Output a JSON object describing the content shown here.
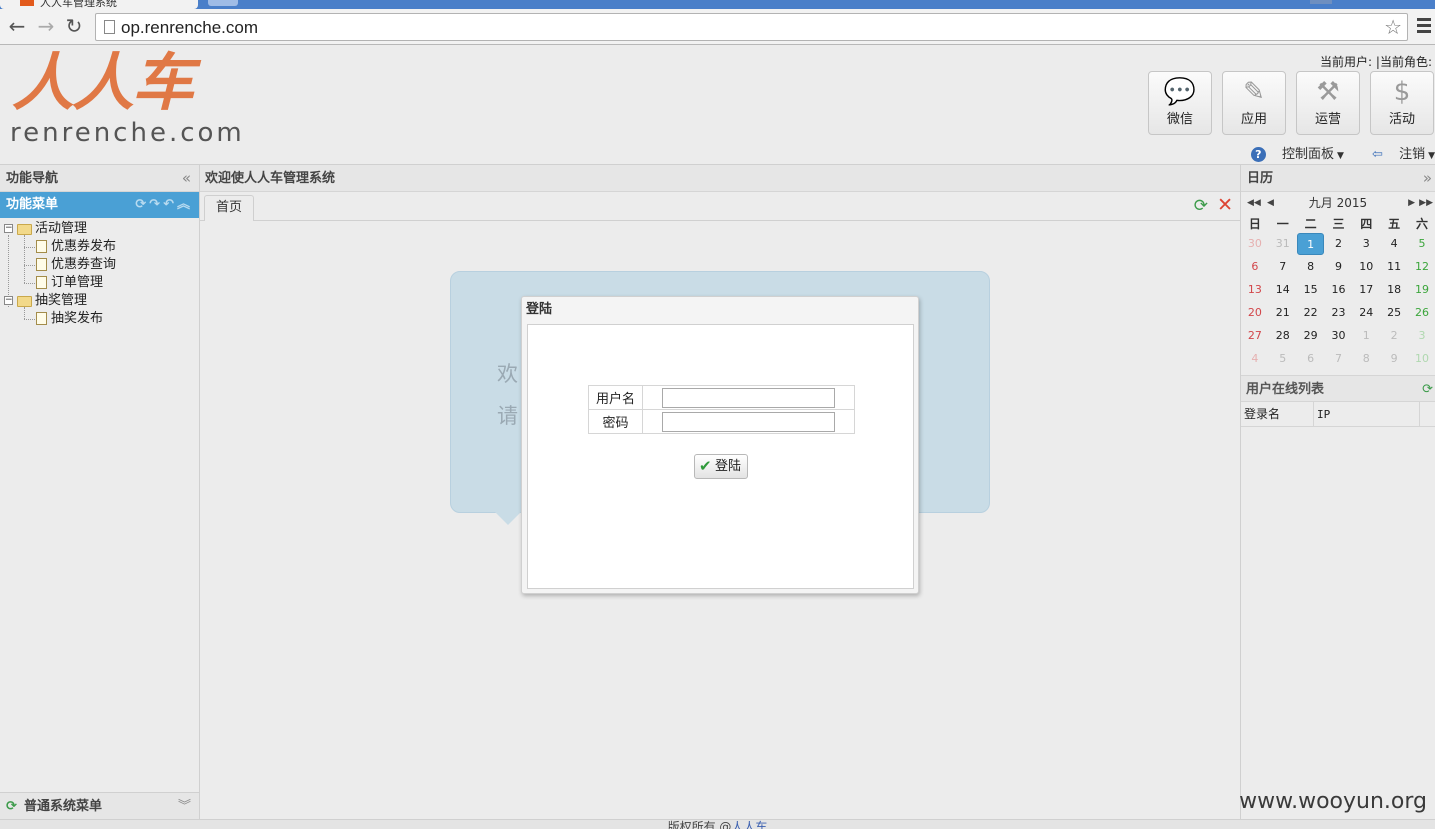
{
  "browser": {
    "tab_title": "人人车管理系统",
    "url": "op.renrenche.com"
  },
  "header": {
    "logo_cn": "人人车",
    "logo_en": "renrenche.com",
    "user_info": "当前用户: |当前角色:",
    "buttons": [
      {
        "label": "微信",
        "icon": "wechat-icon"
      },
      {
        "label": "应用",
        "icon": "pencil-icon"
      },
      {
        "label": "运营",
        "icon": "hammer-icon"
      },
      {
        "label": "活动",
        "icon": "money-bag-icon"
      }
    ],
    "control_panel": "控制面板",
    "logout": "注销"
  },
  "left": {
    "title": "功能导航",
    "menu_title": "功能菜单",
    "tree": [
      {
        "label": "活动管理",
        "children": [
          "优惠券发布",
          "优惠券查询",
          "订单管理"
        ]
      },
      {
        "label": "抽奖管理",
        "children": [
          "抽奖发布"
        ]
      }
    ],
    "bottom_menu": "普通系统菜单"
  },
  "center": {
    "title": "欢迎使人人车管理系统",
    "tab": "首页",
    "bubble_line1": "欢",
    "bubble_line2": "请"
  },
  "login": {
    "title": "登陆",
    "username_label": "用户名",
    "password_label": "密码",
    "username_value": "",
    "password_value": "",
    "submit": "登陆"
  },
  "calendar": {
    "title": "日历",
    "month": "九月",
    "year": "2015",
    "weekdays": [
      "日",
      "一",
      "二",
      "三",
      "四",
      "五",
      "六"
    ],
    "weeks": [
      [
        "30",
        "31",
        "1",
        "2",
        "3",
        "4",
        "5"
      ],
      [
        "6",
        "7",
        "8",
        "9",
        "10",
        "11",
        "12"
      ],
      [
        "13",
        "14",
        "15",
        "16",
        "17",
        "18",
        "19"
      ],
      [
        "20",
        "21",
        "22",
        "23",
        "24",
        "25",
        "26"
      ],
      [
        "27",
        "28",
        "29",
        "30",
        "1",
        "2",
        "3"
      ],
      [
        "4",
        "5",
        "6",
        "7",
        "8",
        "9",
        "10"
      ]
    ],
    "selected_day": "1"
  },
  "online": {
    "title": "用户在线列表",
    "col_login": "登录名",
    "col_ip": "IP"
  },
  "footer": {
    "text": "版权所有 @",
    "link": "人人车"
  },
  "watermark": "www.wooyun.org"
}
